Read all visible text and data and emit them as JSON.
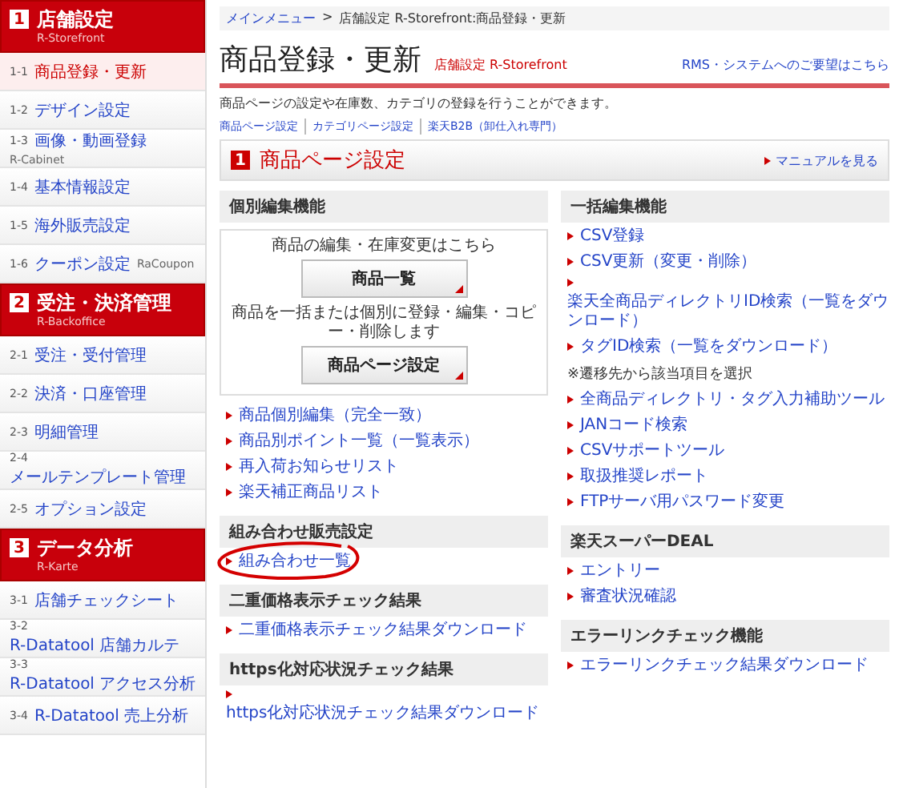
{
  "sidebar": {
    "sections": [
      {
        "number": "1",
        "title": "店舗設定",
        "subtitle": "R-Storefront",
        "items": [
          {
            "code": "1-1",
            "label": "商品登録・更新",
            "selected": true
          },
          {
            "code": "1-2",
            "label": "デザイン設定",
            "selected": false
          },
          {
            "code": "1-3",
            "label": "画像・動画登録",
            "note": "R-Cabinet",
            "selected": false
          },
          {
            "code": "1-4",
            "label": "基本情報設定",
            "selected": false
          },
          {
            "code": "1-5",
            "label": "海外販売設定",
            "selected": false
          },
          {
            "code": "1-6",
            "label": "クーポン設定",
            "note": "RaCoupon",
            "selected": false
          }
        ]
      },
      {
        "number": "2",
        "title": "受注・決済管理",
        "subtitle": "R-Backoffice",
        "items": [
          {
            "code": "2-1",
            "label": "受注・受付管理",
            "selected": false
          },
          {
            "code": "2-2",
            "label": "決済・口座管理",
            "selected": false
          },
          {
            "code": "2-3",
            "label": "明細管理",
            "selected": false
          },
          {
            "code": "2-4",
            "label": "メールテンプレート管理",
            "selected": false
          },
          {
            "code": "2-5",
            "label": "オプション設定",
            "selected": false
          }
        ]
      },
      {
        "number": "3",
        "title": "データ分析",
        "subtitle": "R-Karte",
        "items": [
          {
            "code": "3-1",
            "label": "店舗チェックシート",
            "selected": false
          },
          {
            "code": "3-2",
            "label": "R-Datatool 店舗カルテ",
            "selected": false
          },
          {
            "code": "3-3",
            "label": "R-Datatool アクセス分析",
            "selected": false
          },
          {
            "code": "3-4",
            "label": "R-Datatool 売上分析",
            "selected": false
          }
        ]
      }
    ]
  },
  "breadcrumb": {
    "link": "メインメニュー",
    "separator": ">",
    "current": "店舗設定  R-Storefront:商品登録・更新"
  },
  "page_title": "商品登録・更新",
  "page_category": "店舗設定 R-Storefront",
  "request_link": "RMS・システムへのご要望はこちら",
  "description": "商品ページの設定や在庫数、カテゴリの登録を行うことができます。",
  "nav_links": [
    "商品ページ設定",
    "カテゴリページ設定",
    "楽天B2B（卸仕入れ専門）"
  ],
  "section": {
    "number": "1",
    "title": "商品ページ設定",
    "manual_link": "マニュアルを見る"
  },
  "left_panels": [
    {
      "heading": "個別編集機能",
      "box": [
        {
          "caption": "商品の編集・在庫変更はこちら",
          "button": "商品一覧"
        },
        {
          "caption": "商品を一括または個別に登録・編集・コピー・削除します",
          "button": "商品ページ設定"
        }
      ],
      "links": [
        {
          "text": "商品個別編集（完全一致）"
        },
        {
          "text": "商品別ポイント一覧（一覧表示）"
        },
        {
          "text": "再入荷お知らせリスト"
        },
        {
          "text": "楽天補正商品リスト"
        }
      ]
    },
    {
      "heading": "組み合わせ販売設定",
      "circled": true,
      "links": [
        {
          "text": "組み合わせ一覧"
        }
      ]
    },
    {
      "heading": "二重価格表示チェック結果",
      "links": [
        {
          "text": "二重価格表示チェック結果ダウンロード"
        }
      ]
    },
    {
      "heading": "https化対応状況チェック結果",
      "links": [
        {
          "text": "https化対応状況チェック結果ダウンロード"
        }
      ]
    }
  ],
  "right_panels": [
    {
      "heading": "一括編集機能",
      "links": [
        {
          "text": "CSV登録"
        },
        {
          "text": "CSV更新（変更・削除）"
        },
        {
          "text": "楽天全商品ディレクトリID検索（一覧をダウンロード）"
        },
        {
          "text": "タグID検索（一覧をダウンロード）",
          "note": "※遷移先から該当項目を選択"
        },
        {
          "text": "全商品ディレクトリ・タグ入力補助ツール"
        },
        {
          "text": "JANコード検索"
        },
        {
          "text": "CSVサポートツール"
        },
        {
          "text": "取扱推奨レポート"
        },
        {
          "text": "FTPサーバ用パスワード変更"
        }
      ]
    },
    {
      "heading": "楽天スーパーDEAL",
      "links": [
        {
          "text": "エントリー"
        },
        {
          "text": "審査状況確認"
        }
      ]
    },
    {
      "heading": "エラーリンクチェック機能",
      "links": [
        {
          "text": "エラーリンクチェック結果ダウンロード"
        }
      ]
    }
  ]
}
